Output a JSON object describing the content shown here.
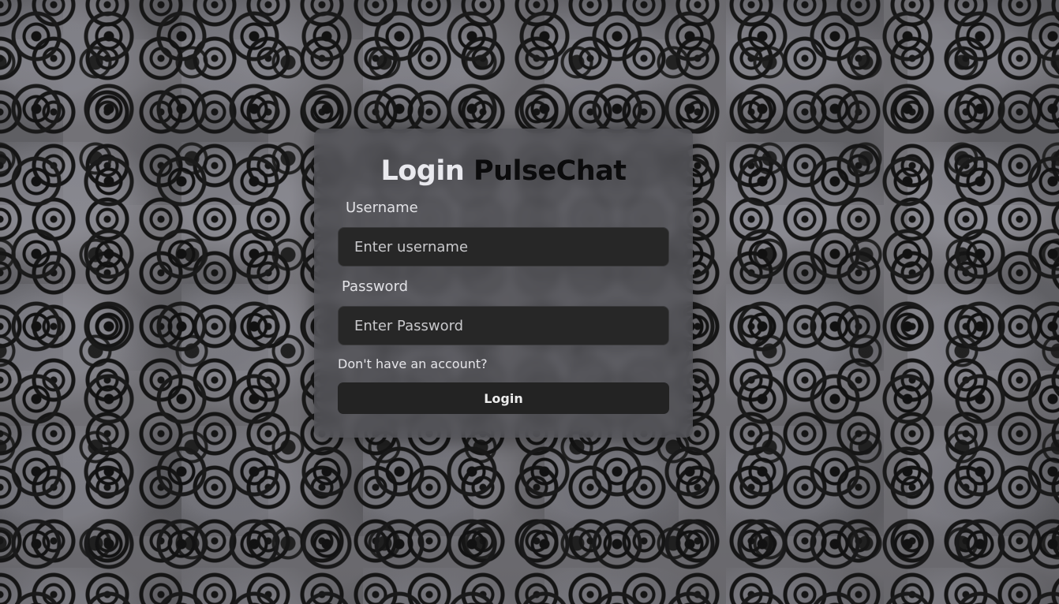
{
  "app": {
    "title_part1": "Login",
    "title_part2": "PulseChat"
  },
  "form": {
    "username_label": "Username",
    "username_placeholder": "Enter username",
    "username_value": "",
    "password_label": "Password",
    "password_placeholder": "Enter Password",
    "password_value": "",
    "signup_link": "Don't have an account?",
    "login_button": "Login"
  },
  "colors": {
    "card_background": "#55555a",
    "input_background": "#272727",
    "button_background": "#232323",
    "title_light": "#e9e9ee",
    "title_dark": "#0b0b0c"
  }
}
